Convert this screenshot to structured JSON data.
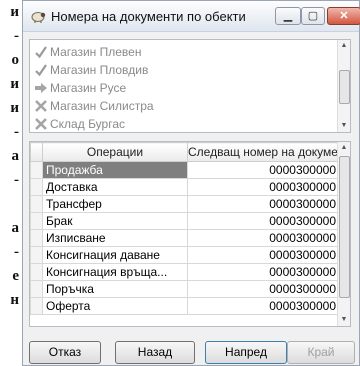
{
  "background_text": [
    "и",
    "-",
    "о",
    "и",
    "и",
    "-",
    "а",
    "-",
    "",
    "а",
    "-",
    "е",
    "н"
  ],
  "window": {
    "title": "Номера на документи по обекти",
    "title_icon": "sheep-icon"
  },
  "listbox": {
    "items": [
      {
        "label": "Магазин Плевен",
        "icon": "checkmark-icon"
      },
      {
        "label": "Магазин Пловдив",
        "icon": "checkmark-icon"
      },
      {
        "label": "Магазин Русе",
        "icon": "arrow-right-icon"
      },
      {
        "label": "Магазин Силистра",
        "icon": "cross-icon"
      },
      {
        "label": "Склад Бургас",
        "icon": "cross-icon"
      }
    ]
  },
  "grid": {
    "headers": [
      "Операции",
      "Следващ номер на документ"
    ],
    "rows": [
      {
        "operation": "Продажба",
        "number": "0000300000",
        "selected": true
      },
      {
        "operation": "Доставка",
        "number": "0000300000"
      },
      {
        "operation": "Трансфер",
        "number": "0000300000"
      },
      {
        "operation": "Брак",
        "number": "0000300000"
      },
      {
        "operation": "Изписване",
        "number": "0000300000"
      },
      {
        "operation": "Консигнация даване",
        "number": "0000300000"
      },
      {
        "operation": "Консигнация връща...",
        "number": "0000300000"
      },
      {
        "operation": "Поръчка",
        "number": "0000300000"
      },
      {
        "operation": "Оферта",
        "number": "0000300000"
      }
    ]
  },
  "buttons": {
    "cancel": "Отказ",
    "back": "Назад",
    "next": "Напред",
    "finish": "Край"
  },
  "colors": {
    "selected_row": "#7f7f7f",
    "close_button": "#d2573f"
  }
}
